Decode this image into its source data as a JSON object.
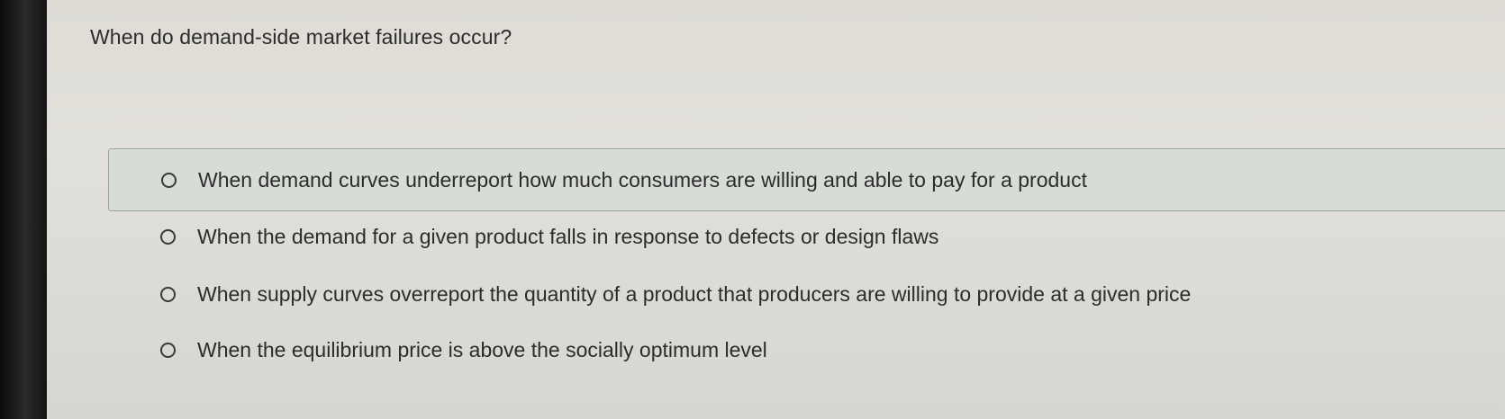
{
  "question": {
    "text": "When do demand-side market failures occur?"
  },
  "options": [
    {
      "label": "When demand curves underreport how much consumers are willing and able to pay for a product",
      "selected": false,
      "highlighted": true
    },
    {
      "label": "When the demand for a given product falls in response to defects or design flaws",
      "selected": false,
      "highlighted": false
    },
    {
      "label": "When supply curves overreport the quantity of a product that producers are willing to provide at a given price",
      "selected": false,
      "highlighted": false
    },
    {
      "label": "When the equilibrium price is above the socially optimum level",
      "selected": false,
      "highlighted": false
    }
  ]
}
